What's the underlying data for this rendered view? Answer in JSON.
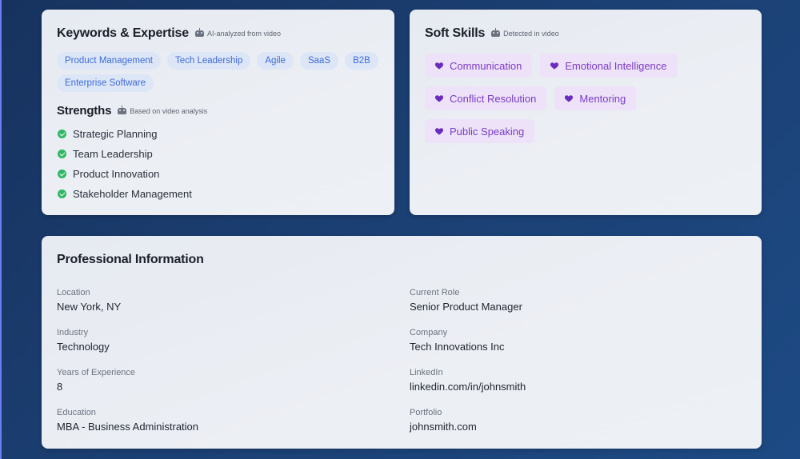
{
  "keywords_card": {
    "title": "Keywords & Expertise",
    "note": "AI-analyzed from video",
    "tags": [
      "Product Management",
      "Tech Leadership",
      "Agile",
      "SaaS",
      "B2B",
      "Enterprise Software"
    ]
  },
  "strengths": {
    "title": "Strengths",
    "note": "Based on video analysis",
    "items": [
      "Strategic Planning",
      "Team Leadership",
      "Product Innovation",
      "Stakeholder Management"
    ]
  },
  "soft_skills_card": {
    "title": "Soft Skills",
    "note": "Detected in video",
    "skills": [
      "Communication",
      "Emotional Intelligence",
      "Conflict Resolution",
      "Mentoring",
      "Public Speaking"
    ]
  },
  "professional_info": {
    "title": "Professional Information",
    "left": [
      {
        "label": "Location",
        "value": "New York, NY"
      },
      {
        "label": "Industry",
        "value": "Technology"
      },
      {
        "label": "Years of Experience",
        "value": "8"
      },
      {
        "label": "Education",
        "value": "MBA - Business Administration"
      }
    ],
    "right": [
      {
        "label": "Current Role",
        "value": "Senior Product Manager"
      },
      {
        "label": "Company",
        "value": "Tech Innovations Inc"
      },
      {
        "label": "LinkedIn",
        "value": "linkedin.com/in/johnsmith"
      },
      {
        "label": "Portfolio",
        "value": "johnsmith.com"
      }
    ]
  },
  "icons": {
    "ai_note": "robot-icon",
    "strength": "check-circle-icon",
    "soft_skill": "heart-icon"
  },
  "colors": {
    "background": "#1b3f72",
    "card": "#e9edf3",
    "keyword_tag_text": "#3d6bd8",
    "keyword_tag_bg": "#dde6f6",
    "soft_tag_text": "#7b3cc6",
    "soft_tag_bg": "#ede2f7",
    "check": "#2fb766"
  }
}
